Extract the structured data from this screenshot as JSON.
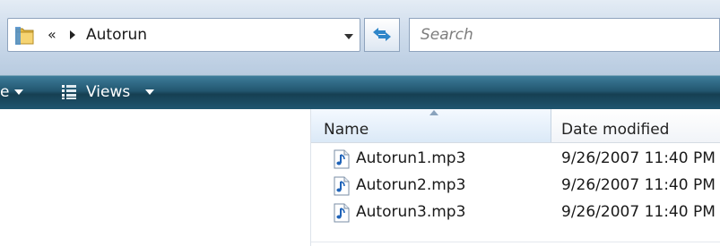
{
  "address_bar": {
    "overflow_glyph": "«",
    "crumb_label": "Autorun",
    "folder_icon": "folder-icon",
    "dropdown_icon": "chevron-down-icon",
    "refresh_icon": "refresh-icon"
  },
  "search": {
    "placeholder": "Search"
  },
  "toolbar": {
    "organize_partial": "e",
    "views_label": "Views",
    "views_icon": "views-list-icon"
  },
  "file_list": {
    "columns": [
      {
        "label": "Name",
        "sorted": "ascending"
      },
      {
        "label": "Date modified"
      }
    ],
    "rows": [
      {
        "name": "Autorun1.mp3",
        "date": "9/26/2007 11:40 PM",
        "icon": "audio-file-icon"
      },
      {
        "name": "Autorun2.mp3",
        "date": "9/26/2007 11:40 PM",
        "icon": "audio-file-icon"
      },
      {
        "name": "Autorun3.mp3",
        "date": "9/26/2007 11:40 PM",
        "icon": "audio-file-icon"
      }
    ]
  },
  "colors": {
    "toolbar_dark": "#163f52",
    "toolbar_light": "#3d7c9a",
    "address_strip": "#cddbeb",
    "header_highlight": "#dbe9f7"
  }
}
